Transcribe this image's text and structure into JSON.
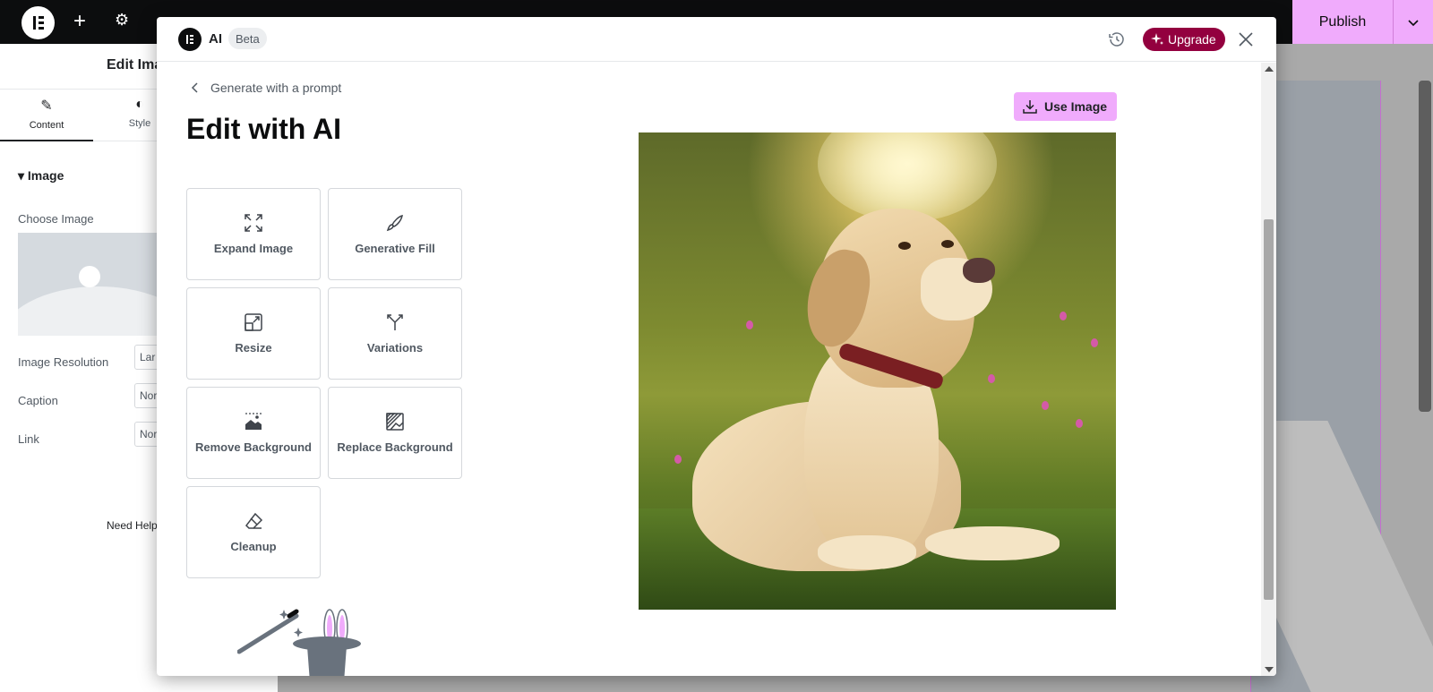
{
  "editor": {
    "topbar": {
      "publish_label": "Publish"
    },
    "panel": {
      "title": "Edit Ima",
      "tabs": [
        {
          "label": "Content",
          "icon": "pencil-icon"
        },
        {
          "label": "Style",
          "icon": "contrast-icon"
        }
      ],
      "section": "Image",
      "choose_image_label": "Choose Image",
      "image_resolution_label": "Image Resolution",
      "image_resolution_value": "Lar",
      "caption_label": "Caption",
      "caption_value": "Nor",
      "link_label": "Link",
      "link_value": "Nor",
      "need_help": "Need Help"
    }
  },
  "modal": {
    "title": "AI",
    "badge": "Beta",
    "upgrade_label": "Upgrade",
    "back_label": "Generate with a prompt",
    "heading": "Edit with AI",
    "use_image_label": "Use Image",
    "tools": [
      {
        "label": "Expand Image",
        "icon": "expand-icon"
      },
      {
        "label": "Generative Fill",
        "icon": "brush-icon"
      },
      {
        "label": "Resize",
        "icon": "resize-icon"
      },
      {
        "label": "Variations",
        "icon": "variations-icon"
      },
      {
        "label": "Remove Background",
        "icon": "remove-background-icon"
      },
      {
        "label": "Replace Background",
        "icon": "replace-background-icon"
      },
      {
        "label": "Cleanup",
        "icon": "eraser-icon"
      }
    ],
    "preview_image": "labrador-dog-in-meadow",
    "colors": {
      "accent_pink": "#f0abfc",
      "upgrade": "#93003f"
    }
  }
}
